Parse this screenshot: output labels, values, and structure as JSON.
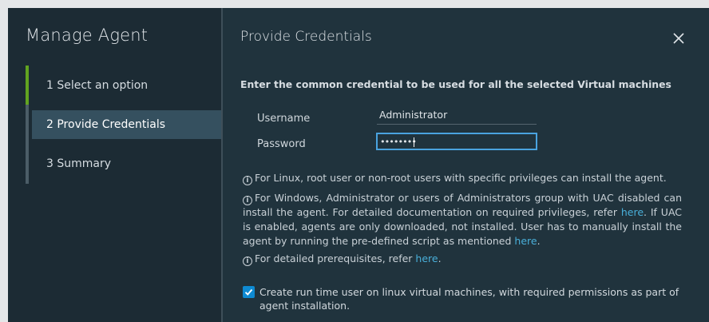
{
  "wizard": {
    "title": "Manage Agent",
    "steps": [
      {
        "label": "1  Select an option"
      },
      {
        "label": "2 Provide Credentials"
      },
      {
        "label": "3 Summary"
      }
    ]
  },
  "panel": {
    "title": "Provide Credentials",
    "intro": "Enter the common credential to be used for all the selected Virtual machines",
    "username_label": "Username",
    "username_value": "Administrator",
    "password_label": "Password",
    "password_value": "••••••••",
    "info": {
      "linux": "For Linux, root user or non-root users with specific privileges can install the agent.",
      "windows_a": "For Windows, Administrator or users of Administrators group with UAC disabled can install the agent. For detailed documentation on required privileges, refer",
      "windows_link1": "here",
      "windows_b": ". If UAC is enabled, agents are only downloaded, not installed. User has to manually install the agent by running the pre-defined script as mentioned",
      "windows_link2": "here",
      "windows_c": ".",
      "prereq_a": "For detailed prerequisites, refer",
      "prereq_link": "here",
      "prereq_b": "."
    },
    "checkbox_label": "Create run time user on linux virtual machines, with required permissions as part of agent installation.",
    "checkbox_checked": true
  },
  "colors": {
    "accent": "#49afd9",
    "step_done": "#62a420",
    "checkbox": "#0e8ad2"
  }
}
